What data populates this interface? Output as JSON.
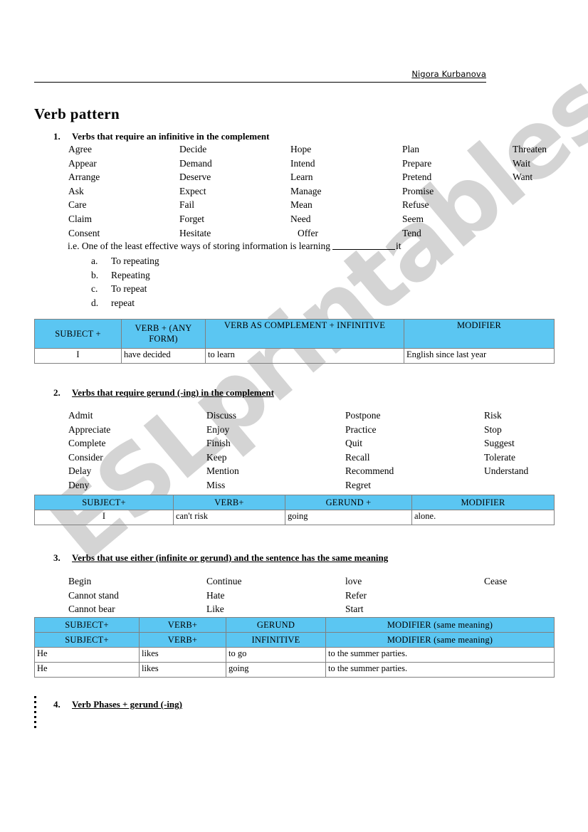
{
  "header": {
    "author": "Nigora Kurbanova"
  },
  "title": "Verb pattern",
  "watermark": "ESLprintables.com",
  "colors": {
    "table_header_bg": "#5BC6F2",
    "table_border": "#808080",
    "watermark": "#d2d2d2"
  },
  "sections": [
    {
      "number": "1.",
      "heading": "Verbs that require an infinitive in the complement",
      "columns": [
        [
          "Agree",
          "Appear",
          "Arrange",
          "Ask",
          "Care",
          "Claim",
          "Consent"
        ],
        [
          "Decide",
          "Demand",
          "Deserve",
          "Expect",
          "Fail",
          "Forget",
          "Hesitate"
        ],
        [
          "Hope",
          "Intend",
          "Learn",
          "Manage",
          "Mean",
          "Need",
          "Offer"
        ],
        [
          "Plan",
          "Prepare",
          "Pretend",
          "Promise",
          "Refuse",
          "Seem",
          "Tend"
        ],
        [
          "Threaten",
          "Wait",
          "Want"
        ]
      ]
    },
    {
      "number": "2.",
      "heading": "Verbs that require gerund (-ing) in the complement",
      "columns": [
        [
          "Admit",
          "Appreciate",
          "Complete",
          "Consider",
          "Delay",
          "Deny"
        ],
        [
          "Discuss",
          "Enjoy",
          "Finish",
          "Keep",
          "Mention",
          "Miss"
        ],
        [
          "Postpone",
          "Practice",
          "Quit",
          "Recall",
          "Recommend",
          "Regret"
        ],
        [
          "Risk",
          "Stop",
          "Suggest",
          "Tolerate",
          "Understand"
        ]
      ]
    },
    {
      "number": "3.",
      "heading": "Verbs that use either (infinite or gerund) and the sentence has the same meaning",
      "columns": [
        [
          "Begin",
          "Cannot stand",
          "Cannot bear"
        ],
        [
          "Continue",
          "Hate",
          "Like"
        ],
        [
          "love",
          "Refer",
          "Start"
        ],
        [
          "Cease"
        ]
      ]
    },
    {
      "number": "4.",
      "heading": "Verb Phases + gerund (-ing)",
      "columns": []
    }
  ],
  "example": {
    "prefix": "i.e. One of the least effective ways of storing information is learning",
    "suffix": "it",
    "choices": [
      {
        "letter": "a.",
        "text": "To repeating"
      },
      {
        "letter": "b.",
        "text": "Repeating"
      },
      {
        "letter": "c.",
        "text": "To repeat"
      },
      {
        "letter": "d.",
        "text": "repeat"
      }
    ]
  },
  "tables": [
    {
      "name": "infinitive-pattern-table",
      "headers": [
        "SUBJECT +",
        "VERB + (ANY FORM)",
        "VERB AS COMPLEMENT + INFINITIVE",
        "MODIFIER"
      ],
      "rows": [
        [
          "I",
          "have decided",
          "to learn",
          "English since last year"
        ]
      ]
    },
    {
      "name": "gerund-pattern-table",
      "headers": [
        "SUBJECT+",
        "VERB+",
        "GERUND +",
        "MODIFIER"
      ],
      "rows": [
        [
          "I",
          "can't risk",
          "going",
          "alone."
        ]
      ]
    },
    {
      "name": "either-pattern-table",
      "headers_row1": [
        "SUBJECT+",
        "VERB+",
        "GERUND",
        "MODIFIER (same meaning)"
      ],
      "headers_row2": [
        "SUBJECT+",
        "VERB+",
        "INFINITIVE",
        "MODIFIER (same meaning)"
      ],
      "rows": [
        [
          "He",
          "likes",
          "to go",
          "to the summer parties."
        ],
        [
          "He",
          "likes",
          "going",
          " to the summer parties."
        ]
      ]
    }
  ]
}
